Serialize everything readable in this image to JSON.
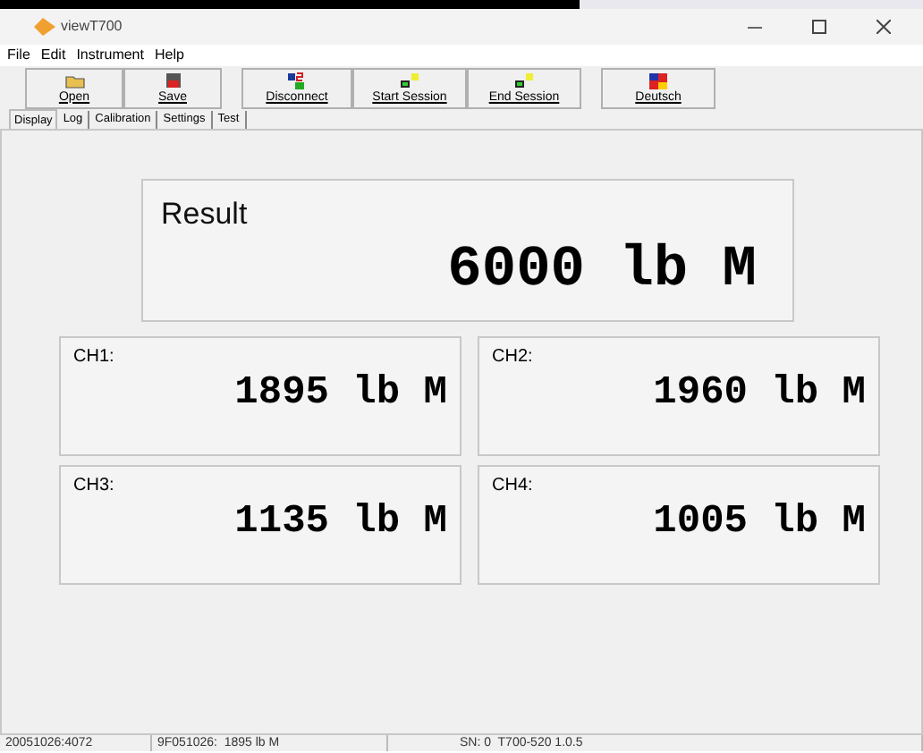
{
  "window": {
    "title": "viewT700"
  },
  "menu": [
    "File",
    "Edit",
    "Instrument",
    "Help"
  ],
  "toolbar": [
    {
      "label": "Open"
    },
    {
      "label": "Save"
    },
    {
      "label": "Disconnect"
    },
    {
      "label": "Start Session"
    },
    {
      "label": "End Session"
    },
    {
      "label": "Deutsch"
    }
  ],
  "tabs": [
    {
      "label": "Display",
      "selected": true
    },
    {
      "label": "Log",
      "selected": false
    },
    {
      "label": "Calibration",
      "selected": false
    },
    {
      "label": "Settings",
      "selected": false
    },
    {
      "label": "Test",
      "selected": false
    }
  ],
  "result": {
    "label": "Result",
    "value": "6000 lb M"
  },
  "channels": [
    {
      "label": "CH1:",
      "value": "1895 lb M"
    },
    {
      "label": "CH2:",
      "value": "1960 lb M"
    },
    {
      "label": "CH3:",
      "value": "1135 lb M"
    },
    {
      "label": "CH4:",
      "value": "1005 lb M"
    }
  ],
  "status_bar": [
    "20051026:4072",
    "9F051026:  1895 lb M",
    "SN: 0  T700-520 1.0.5"
  ]
}
